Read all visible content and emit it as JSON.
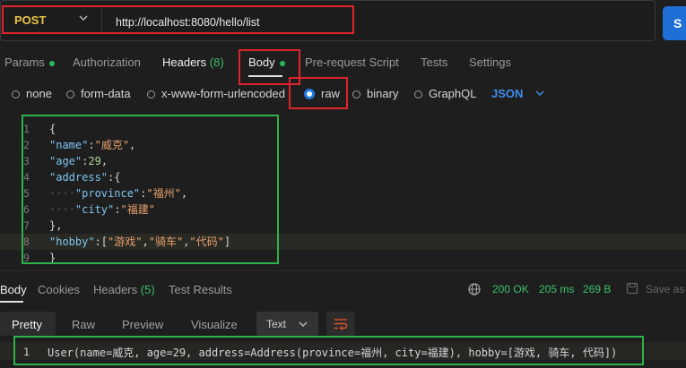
{
  "request": {
    "method": "POST",
    "url": "http://localhost:8080/hello/list",
    "send_label": "S"
  },
  "request_tabs": [
    {
      "label": "Params",
      "dot": true
    },
    {
      "label": "Authorization"
    },
    {
      "label": "Headers",
      "count": "(8)"
    },
    {
      "label": "Body",
      "dot": true,
      "active": true
    },
    {
      "label": "Pre-request Script"
    },
    {
      "label": "Tests"
    },
    {
      "label": "Settings"
    }
  ],
  "body_types": {
    "none": "none",
    "form_data": "form-data",
    "urlencoded": "x-www-form-urlencoded",
    "raw": "raw",
    "binary": "binary",
    "graphql": "GraphQL",
    "format": "JSON"
  },
  "editor_lines": [
    {
      "n": "1",
      "tokens": [
        [
          "p",
          "{"
        ]
      ]
    },
    {
      "n": "2",
      "tokens": [
        [
          "k",
          "\"name\""
        ],
        [
          "p",
          ":"
        ],
        [
          "s",
          "\"威克\""
        ],
        [
          "p",
          ","
        ]
      ]
    },
    {
      "n": "3",
      "tokens": [
        [
          "k",
          "\"age\""
        ],
        [
          "p",
          ":"
        ],
        [
          "n",
          "29"
        ],
        [
          "p",
          ","
        ]
      ]
    },
    {
      "n": "4",
      "tokens": [
        [
          "k",
          "\"address\""
        ],
        [
          "p",
          ":{"
        ]
      ]
    },
    {
      "n": "5",
      "tokens": [
        [
          "g",
          "····"
        ],
        [
          "k",
          "\"province\""
        ],
        [
          "p",
          ":"
        ],
        [
          "s",
          "\"福州\""
        ],
        [
          "p",
          ","
        ]
      ]
    },
    {
      "n": "6",
      "tokens": [
        [
          "g",
          "····"
        ],
        [
          "k",
          "\"city\""
        ],
        [
          "p",
          ":"
        ],
        [
          "s",
          "\"福建\""
        ]
      ]
    },
    {
      "n": "7",
      "tokens": [
        [
          "p",
          "},"
        ]
      ]
    },
    {
      "n": "8",
      "tokens": [
        [
          "k",
          "\"hobby\""
        ],
        [
          "p",
          ":["
        ],
        [
          "s",
          "\"游戏\""
        ],
        [
          "p",
          ","
        ],
        [
          "s",
          "\"骑车\""
        ],
        [
          "p",
          ","
        ],
        [
          "s",
          "\"代码\""
        ],
        [
          "p",
          "]"
        ]
      ]
    },
    {
      "n": "9",
      "tokens": [
        [
          "p",
          "}"
        ]
      ]
    }
  ],
  "response_tabs": {
    "body": "Body",
    "cookies": "Cookies",
    "headers": "Headers",
    "headers_count": "(5)",
    "test_results": "Test Results"
  },
  "status": {
    "code": "200 OK",
    "time": "205 ms",
    "size": "269 B",
    "save": "Save as"
  },
  "format_tabs": {
    "pretty": "Pretty",
    "raw": "Raw",
    "preview": "Preview",
    "visualize": "Visualize",
    "type": "Text"
  },
  "response_line": {
    "n": "1",
    "text": "User(name=威克, age=29, address=Address(province=福州, city=福建), hobby=[游戏, 骑车, 代码])"
  },
  "colors": {
    "accent": "#1f6fd6",
    "method": "#e8c547",
    "success": "#3cc16a",
    "annotation_red": "#e0242b",
    "annotation_green": "#2fb24a"
  }
}
